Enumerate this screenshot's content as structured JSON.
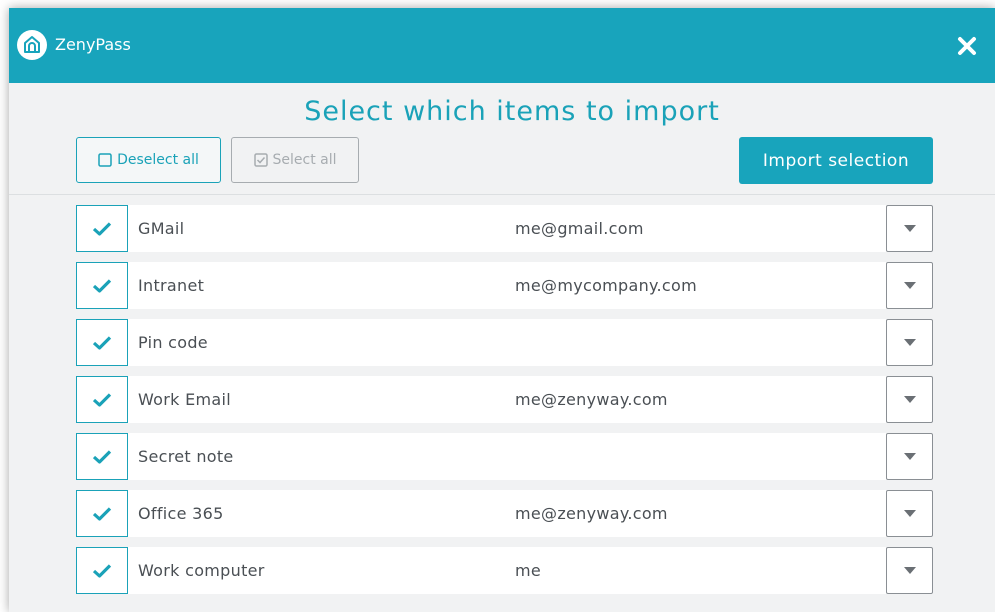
{
  "app": {
    "title": "ZenyPass",
    "logo_icon": "home-lock-icon",
    "close_icon": "close-icon"
  },
  "dialog": {
    "heading": "Select which items to import",
    "deselect_all_label": "Deselect all",
    "select_all_label": "Select all",
    "import_label": "Import selection"
  },
  "colors": {
    "accent": "#18a4bc",
    "text": "#4a4f54",
    "disabled": "#a7acb0",
    "background": "#f1f2f3"
  },
  "items": [
    {
      "name": "GMail",
      "login": "me@gmail.com",
      "checked": true
    },
    {
      "name": "Intranet",
      "login": "me@mycompany.com",
      "checked": true
    },
    {
      "name": "Pin code",
      "login": "",
      "checked": true
    },
    {
      "name": "Work Email",
      "login": "me@zenyway.com",
      "checked": true
    },
    {
      "name": "Secret note",
      "login": "",
      "checked": true
    },
    {
      "name": "Office 365",
      "login": "me@zenyway.com",
      "checked": true
    },
    {
      "name": "Work computer",
      "login": "me",
      "checked": true
    }
  ]
}
